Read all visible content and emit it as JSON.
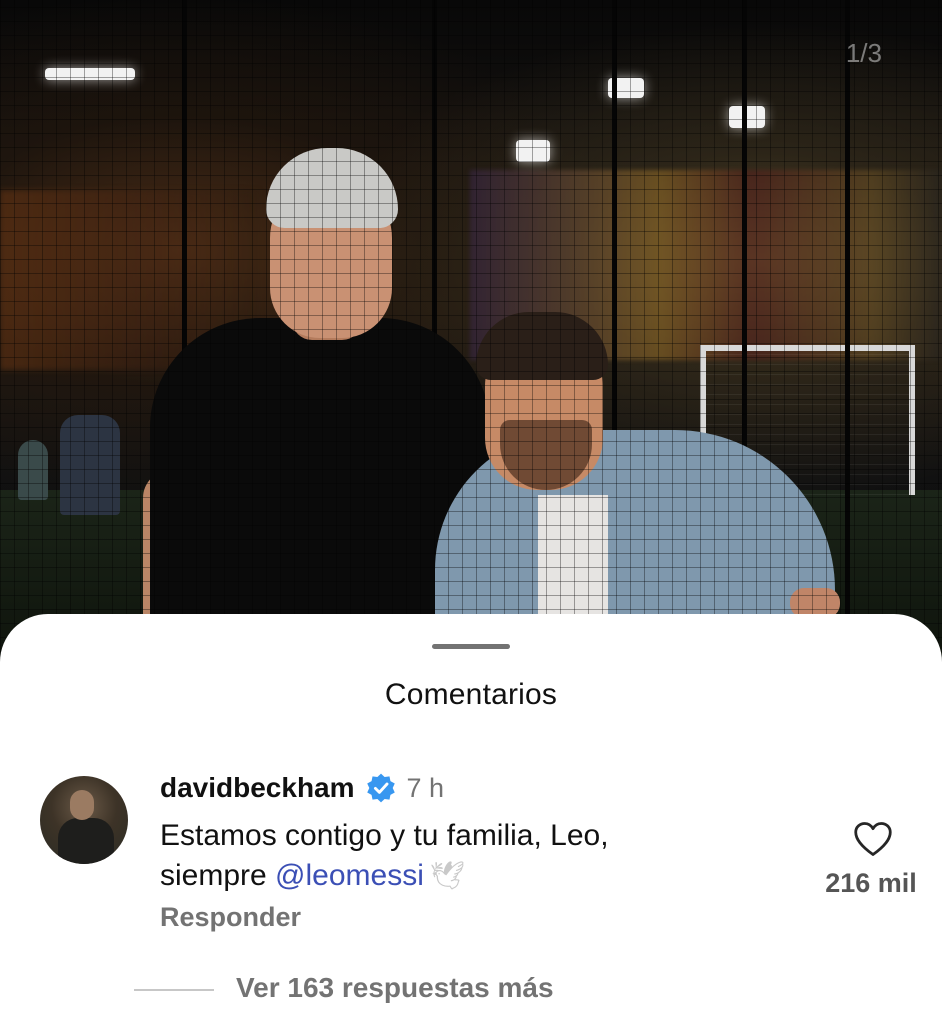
{
  "photo": {
    "counter": "1/3"
  },
  "comments_sheet": {
    "title": "Comentarios",
    "comment": {
      "username": "davidbeckham",
      "verified": true,
      "timestamp": "7 h",
      "text_line1": "Estamos contigo y tu familia, Leo,",
      "text_line2_prefix": "siempre",
      "mention": "@leomessi",
      "emoji": "dove",
      "reply_label": "Responder",
      "like_count": "216 mil"
    },
    "view_replies": "Ver 163 respuestas más"
  },
  "colors": {
    "mention": "#3b4fb5",
    "verified_badge": "#3897f0",
    "secondary_text": "#737373"
  }
}
